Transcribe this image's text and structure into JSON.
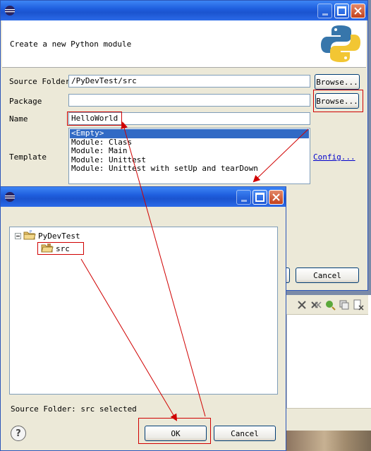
{
  "main_dialog": {
    "header_text": "Create a new Python module",
    "logo_icon": "python-logo-icon",
    "source_folder_label": "Source Folder",
    "source_folder_value": "/PyDevTest/src",
    "package_label": "Package",
    "package_value": "",
    "name_label": "Name",
    "name_value": "HelloWorld",
    "template_label": "Template",
    "browse_label": "Browse...",
    "config_link": "Config...",
    "templates": [
      "<Empty>",
      "Module: Class",
      "Module: Main",
      "Module: Unittest",
      "Module: Unittest with setUp and tearDown"
    ],
    "selected_template": "<Empty>",
    "cancel_label": "Cancel",
    "title_icon": "eclipse-icon"
  },
  "folder_dialog": {
    "title_icon": "eclipse-icon",
    "tree": {
      "root_label": "PyDevTest",
      "root_icon": "project-folder-icon",
      "child_label": "src",
      "child_icon": "source-folder-icon"
    },
    "status_text": "Source Folder: src selected",
    "help_label": "?",
    "ok_label": "OK",
    "cancel_label": "Cancel"
  },
  "colors": {
    "titlebar_blue": "#1f5fde",
    "annotation_red": "#d00000",
    "selection_blue": "#316ac5",
    "dialog_bg": "#ece9d8"
  }
}
